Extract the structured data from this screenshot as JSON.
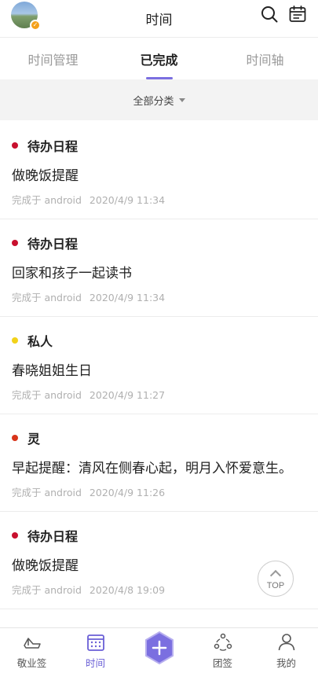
{
  "header": {
    "title": "时间",
    "icons": {
      "search": "search-icon",
      "calendar": "calendar-icon"
    }
  },
  "tabs": [
    {
      "label": "时间管理",
      "active": false
    },
    {
      "label": "已完成",
      "active": true
    },
    {
      "label": "时间轴",
      "active": false
    }
  ],
  "filter": {
    "label": "全部分类"
  },
  "items": [
    {
      "category": "待办日程",
      "color": "#c8102e",
      "title": "做晚饭提醒",
      "device": "完成于 android",
      "datetime": "2020/4/9  11:34"
    },
    {
      "category": "待办日程",
      "color": "#c8102e",
      "title": "回家和孩子一起读书",
      "device": "完成于 android",
      "datetime": "2020/4/9  11:34"
    },
    {
      "category": "私人",
      "color": "#f2d21a",
      "title": "春晓姐姐生日",
      "device": "完成于 android",
      "datetime": "2020/4/9  11:27"
    },
    {
      "category": "灵",
      "color": "#d8341a",
      "title": "早起提醒：清风在侧春心起，明月入怀爱意生。",
      "device": "完成于 android",
      "datetime": "2020/4/9  11:26"
    },
    {
      "category": "待办日程",
      "color": "#c8102e",
      "title": "做晚饭提醒",
      "device": "完成于 android",
      "datetime": "2020/4/8  19:09"
    }
  ],
  "top_button": {
    "label": "TOP"
  },
  "bottom_nav": [
    {
      "label": "敬业签",
      "icon": "boat-icon",
      "active": false
    },
    {
      "label": "时间",
      "icon": "calendar-grid-icon",
      "active": true
    },
    {
      "label": "",
      "icon": "plus-icon",
      "active": false
    },
    {
      "label": "团签",
      "icon": "team-icon",
      "active": false
    },
    {
      "label": "我的",
      "icon": "person-icon",
      "active": false
    }
  ],
  "colors": {
    "accent": "#6a5fd6",
    "text_muted": "#b0b0b0"
  }
}
